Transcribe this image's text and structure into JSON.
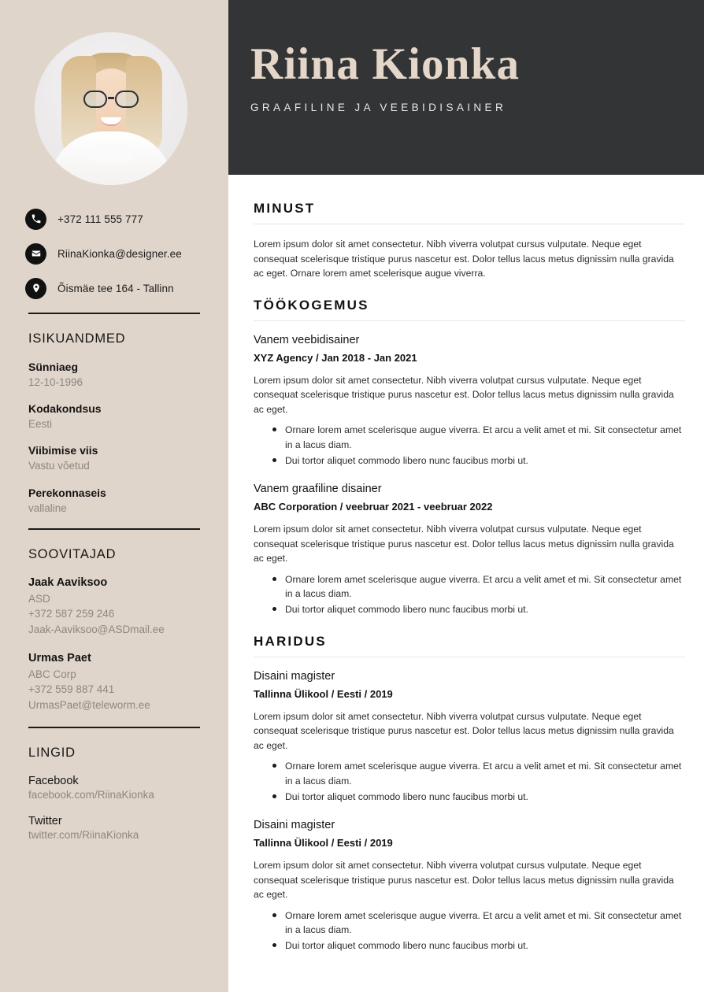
{
  "header": {
    "name": "Riina Kionka",
    "subtitle": "GRAAFILINE JA VEEBIDISAINER",
    "background_color": "#333436",
    "name_color": "#e4d6c8"
  },
  "sidebar": {
    "background_color": "#e0d5ca",
    "avatar": "portrait-photo",
    "contact": [
      {
        "icon": "phone-icon",
        "text": "+372 111 555 777"
      },
      {
        "icon": "envelope-icon",
        "text": "RiinaKionka@designer.ee"
      },
      {
        "icon": "location-pin-icon",
        "text": "Õismäe tee 164 - Tallinn"
      }
    ],
    "personal": {
      "heading": "ISIKUANDMED",
      "fields": [
        {
          "label": "Sünniaeg",
          "value": "12-10-1996"
        },
        {
          "label": "Kodakondsus",
          "value": "Eesti"
        },
        {
          "label": "Viibimise viis",
          "value": "Vastu võetud"
        },
        {
          "label": "Perekonnaseis",
          "value": "vallaline"
        }
      ]
    },
    "references": {
      "heading": "SOOVITAJAD",
      "items": [
        {
          "name": "Jaak Aaviksoo",
          "company": "ASD",
          "phone": " +372 587 259 246",
          "email": "Jaak-Aaviksoo@ASDmail.ee"
        },
        {
          "name": "Urmas Paet",
          "company": "ABC Corp",
          "phone": " +372 559 887 441",
          "email": "UrmasPaet@teleworm.ee"
        }
      ]
    },
    "links": {
      "heading": "LINGID",
      "items": [
        {
          "title": "Facebook",
          "url": "facebook.com/RiinaKionka"
        },
        {
          "title": "Twitter",
          "url": "twitter.com/RiinaKionka"
        }
      ]
    }
  },
  "main": {
    "about": {
      "heading": "MINUST",
      "text": "Lorem ipsum dolor sit amet consectetur. Nibh viverra volutpat cursus vulputate. Neque eget consequat scelerisque tristique purus nascetur est. Dolor tellus lacus metus dignissim nulla gravida ac eget. Ornare lorem amet scelerisque augue viverra."
    },
    "experience": {
      "heading": "TÖÖKOGEMUS",
      "entries": [
        {
          "title": "Vanem veebidisainer",
          "meta": "XYZ Agency / Jan 2018 - Jan 2021",
          "desc": "Lorem ipsum dolor sit amet consectetur. Nibh viverra volutpat cursus vulputate. Neque eget consequat scelerisque tristique purus nascetur est. Dolor tellus lacus metus dignissim nulla gravida ac eget.",
          "bullets": [
            "Ornare lorem amet scelerisque augue viverra. Et arcu a velit amet et mi. Sit consectetur amet in a lacus diam.",
            "Dui tortor aliquet commodo libero nunc faucibus morbi ut."
          ]
        },
        {
          "title": "Vanem graafiline disainer",
          "meta": "ABC Corporation / veebruar 2021 - veebruar 2022",
          "desc": "Lorem ipsum dolor sit amet consectetur. Nibh viverra volutpat cursus vulputate. Neque eget consequat scelerisque tristique purus nascetur est. Dolor tellus lacus metus dignissim nulla gravida ac eget.",
          "bullets": [
            "Ornare lorem amet scelerisque augue viverra. Et arcu a velit amet et mi. Sit consectetur amet in a lacus diam.",
            "Dui tortor aliquet commodo libero nunc faucibus morbi ut."
          ]
        }
      ]
    },
    "education": {
      "heading": "HARIDUS",
      "entries": [
        {
          "title": "Disaini magister",
          "meta": "Tallinna Ülikool / Eesti / 2019",
          "desc": "Lorem ipsum dolor sit amet consectetur. Nibh viverra volutpat cursus vulputate. Neque eget consequat scelerisque tristique purus nascetur est. Dolor tellus lacus metus dignissim nulla gravida ac eget.",
          "bullets": [
            "Ornare lorem amet scelerisque augue viverra. Et arcu a velit amet et mi. Sit consectetur amet in a lacus diam.",
            "Dui tortor aliquet commodo libero nunc faucibus morbi ut."
          ]
        },
        {
          "title": "Disaini magister",
          "meta": "Tallinna Ülikool / Eesti / 2019",
          "desc": "Lorem ipsum dolor sit amet consectetur. Nibh viverra volutpat cursus vulputate. Neque eget consequat scelerisque tristique purus nascetur est. Dolor tellus lacus metus dignissim nulla gravida ac eget.",
          "bullets": [
            "Ornare lorem amet scelerisque augue viverra. Et arcu a velit amet et mi. Sit consectetur amet in a lacus diam.",
            "Dui tortor aliquet commodo libero nunc faucibus morbi ut."
          ]
        }
      ]
    }
  }
}
